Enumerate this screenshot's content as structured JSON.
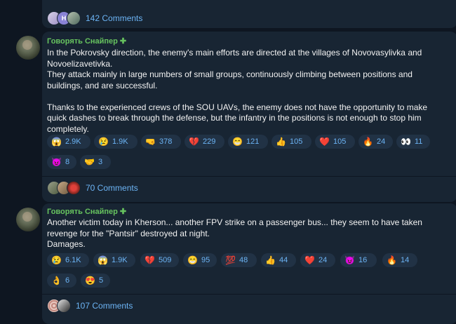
{
  "thread_top": {
    "comments_label": "142 Comments",
    "mini_letter": "H"
  },
  "posts": [
    {
      "author": "Говорять Снайпер",
      "author_mark": "✚",
      "text": "In the Pokrovsky direction, the enemy's main efforts are directed at the villages of Novovasylivka and Novoelizavetivka.\nThey attack mainly in large numbers of small groups, continuously climbing between positions and buildings, and are successful.\n\nThanks to the experienced crews of the SOU UAVs, the enemy does not have the opportunity to make quick dashes to break through the defense, but the infantry in the positions is not enough to stop him completely.",
      "reactions": [
        {
          "emoji": "😱",
          "count": "2.9K"
        },
        {
          "emoji": "😢",
          "count": "1.9K"
        },
        {
          "emoji": "🤜",
          "count": "378"
        },
        {
          "emoji": "💔",
          "count": "229"
        },
        {
          "emoji": "😁",
          "count": "121"
        },
        {
          "emoji": "👍",
          "count": "105"
        },
        {
          "emoji": "❤️",
          "count": "105"
        },
        {
          "emoji": "🔥",
          "count": "24"
        },
        {
          "emoji": "👀",
          "count": "11"
        },
        {
          "emoji": "😈",
          "count": "8"
        },
        {
          "emoji": "🤝",
          "count": "3"
        }
      ],
      "comments_label": "70 Comments"
    },
    {
      "author": "Говорять Снайпер",
      "author_mark": "✚",
      "text": "Another victim today in Kherson... another FPV strike on a passenger bus... they seem to have taken revenge for the \"Pantsir\" destroyed at night.\nDamages.",
      "reactions": [
        {
          "emoji": "😢",
          "count": "6.1K"
        },
        {
          "emoji": "😱",
          "count": "1.9K"
        },
        {
          "emoji": "💔",
          "count": "509"
        },
        {
          "emoji": "😁",
          "count": "95"
        },
        {
          "emoji": "💯",
          "count": "48"
        },
        {
          "emoji": "👍",
          "count": "44"
        },
        {
          "emoji": "❤️",
          "count": "24"
        },
        {
          "emoji": "😈",
          "count": "16"
        },
        {
          "emoji": "🔥",
          "count": "14"
        },
        {
          "emoji": "👌",
          "count": "6"
        },
        {
          "emoji": "😍",
          "count": "5"
        }
      ],
      "comments_label": "107 Comments"
    }
  ],
  "colors": {
    "background": "#0e1621",
    "bubble": "#182533",
    "chip": "#213245",
    "link": "#6cb4f5",
    "author": "#67c35f"
  }
}
